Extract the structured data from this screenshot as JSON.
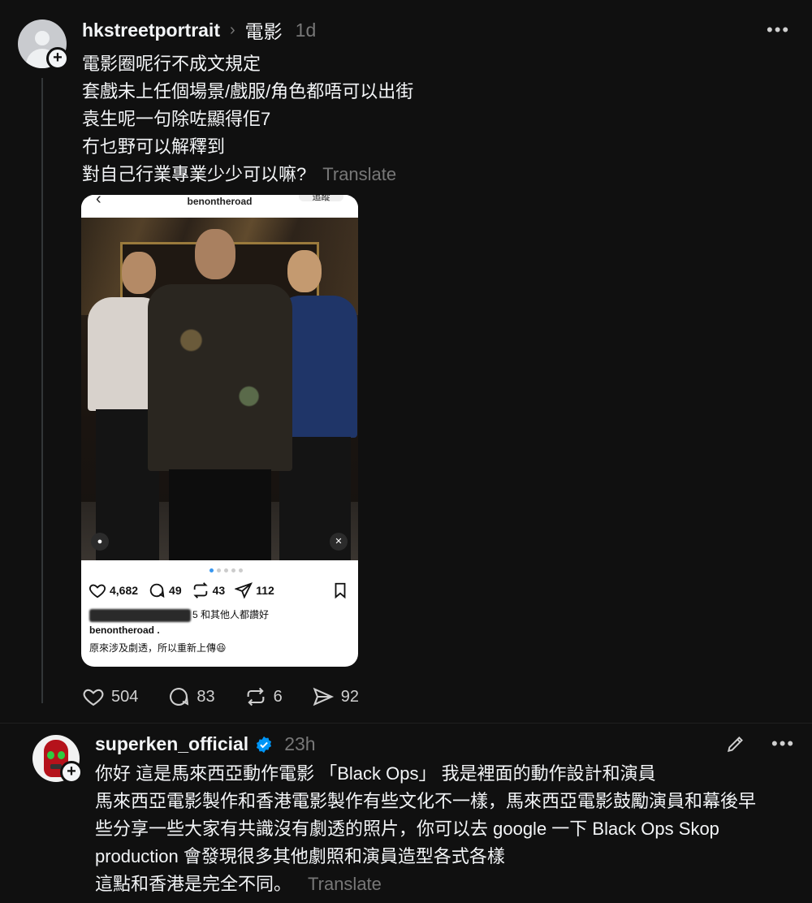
{
  "post": {
    "username": "hkstreetportrait",
    "topic": "電影",
    "time": "1d",
    "lines": [
      "電影圈呢行不成文規定",
      "套戲未上任個場景/戲服/角色都唔可以出街",
      "袁生呢一句除咗顯得佢7",
      "冇乜野可以解釋到",
      "對自己行業專業少少可以嘛?"
    ],
    "translate": "Translate",
    "stats": {
      "likes": "504",
      "comments": "83",
      "reposts": "6",
      "shares": "92"
    }
  },
  "embedded": {
    "account": "benontheroad",
    "follow": "追蹤",
    "likes": "4,682",
    "comments": "49",
    "reposts": "43",
    "shares": "112",
    "liked_by_visible": "5 和其他人都讚好",
    "caption_user": "benontheroad .",
    "caption": "原來涉及劇透，所以重新上傳😆"
  },
  "reply": {
    "username": "superken_official",
    "time": "23h",
    "lines": [
      "你好 這是馬來西亞動作電影 「Black Ops」 我是裡面的動作設計和演員",
      "馬來西亞電影製作和香港電影製作有些文化不一樣，馬來西亞電影鼓勵演員和幕後早",
      "些分享一些大家有共識沒有劇透的照片，你可以去 google 一下 Black Ops Skop",
      "production 會發現很多其他劇照和演員造型各式各樣",
      "這點和香港是完全不同。"
    ],
    "translate": "Translate"
  },
  "colors": {
    "background": "#101010",
    "text": "#f3f5f7",
    "muted": "#777777",
    "verified": "#0095f6",
    "mask": "#b5121b"
  }
}
